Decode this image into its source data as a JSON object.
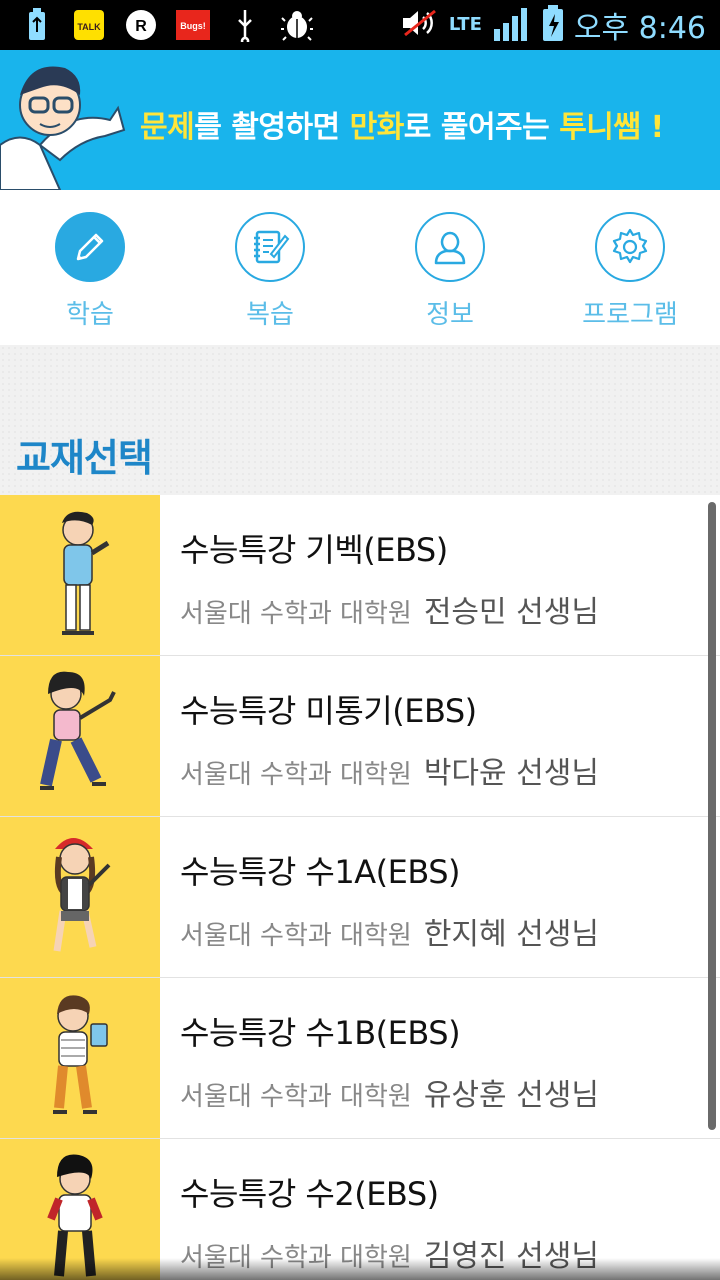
{
  "status_bar": {
    "icons": [
      "usb-battery-icon",
      "kakaotalk-icon",
      "r-app-icon",
      "bugs-icon",
      "usb-icon",
      "debug-bug-icon"
    ],
    "talk_label": "TALK",
    "bugs_label": "Bugs!",
    "r_label": "R",
    "network": "LTE",
    "time": "오후 8:46"
  },
  "banner": {
    "text_part1": "문제",
    "text_part2": "를 촬영하면 ",
    "text_part3": "만화",
    "text_part4": "로 풀어주는 ",
    "text_part5": "투니쌤",
    "text_part6": " !"
  },
  "tabs": [
    {
      "label": "학습",
      "icon": "pencil-icon",
      "active": true
    },
    {
      "label": "복습",
      "icon": "notebook-icon",
      "active": false
    },
    {
      "label": "정보",
      "icon": "person-icon",
      "active": false
    },
    {
      "label": "프로그램",
      "icon": "gear-icon",
      "active": false
    }
  ],
  "section": {
    "title": "교재선택"
  },
  "books": [
    {
      "title": "수능특강 기벡(EBS)",
      "school": "서울대 수학과 대학원",
      "teacher": "전승민 선생님"
    },
    {
      "title": "수능특강 미통기(EBS)",
      "school": "서울대 수학과 대학원",
      "teacher": "박다윤 선생님"
    },
    {
      "title": "수능특강 수1A(EBS)",
      "school": "서울대 수학과 대학원",
      "teacher": "한지혜 선생님"
    },
    {
      "title": "수능특강 수1B(EBS)",
      "school": "서울대 수학과 대학원",
      "teacher": "유상훈 선생님"
    },
    {
      "title": "수능특강 수2(EBS)",
      "school": "서울대 수학과 대학원",
      "teacher": "김영진 선생님"
    }
  ],
  "colors": {
    "banner_bg": "#19b4ec",
    "highlight": "#ffe53a",
    "accent": "#29a9e1",
    "section_title": "#1e86c8",
    "thumb_bg": "#fdd94f"
  }
}
